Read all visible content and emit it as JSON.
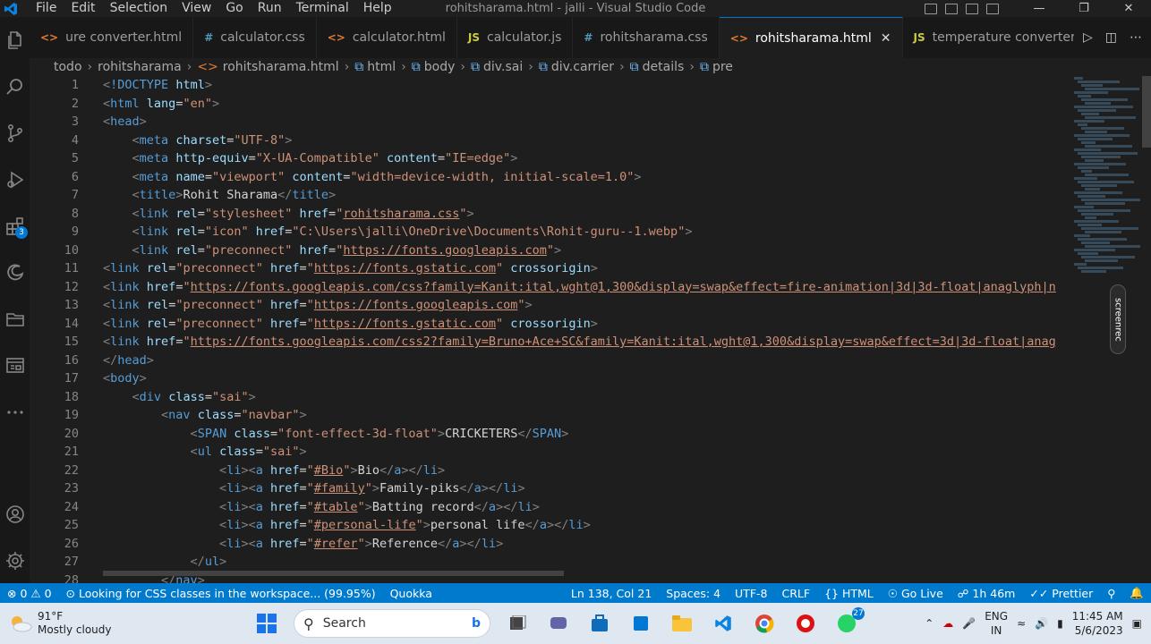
{
  "window": {
    "title": "rohitsharama.html - jalli - Visual Studio Code"
  },
  "menu": [
    "File",
    "Edit",
    "Selection",
    "View",
    "Go",
    "Run",
    "Terminal",
    "Help"
  ],
  "activity_badge": "3",
  "tabs": [
    {
      "label": "ure converter.html",
      "kind": "html",
      "glyph": "<>",
      "active": false
    },
    {
      "label": "calculator.css",
      "kind": "css",
      "glyph": "#",
      "active": false
    },
    {
      "label": "calculator.html",
      "kind": "html",
      "glyph": "<>",
      "active": false
    },
    {
      "label": "calculator.js",
      "kind": "js",
      "glyph": "JS",
      "active": false
    },
    {
      "label": "rohitsharama.css",
      "kind": "css",
      "glyph": "#",
      "active": false
    },
    {
      "label": "rohitsharama.html",
      "kind": "html",
      "glyph": "<>",
      "active": true
    },
    {
      "label": "temperature converter.js",
      "kind": "js",
      "glyph": "JS",
      "active": false
    }
  ],
  "breadcrumb": [
    "todo",
    "rohitsharama",
    "rohitsharama.html",
    "html",
    "body",
    "div.sai",
    "div.carrier",
    "details",
    "pre"
  ],
  "code_lines": [
    {
      "n": "1",
      "html": "<span class='t'>&lt;</span><span class='tg'>!DOCTYPE</span> <span class='at'>html</span><span class='t'>&gt;</span>"
    },
    {
      "n": "2",
      "html": "<span class='t'>&lt;</span><span class='tg'>html</span> <span class='at'>lang</span>=<span class='st'>\"en\"</span><span class='t'>&gt;</span>"
    },
    {
      "n": "3",
      "html": "<span class='t'>&lt;</span><span class='tg'>head</span><span class='t'>&gt;</span>"
    },
    {
      "n": "4",
      "html": "    <span class='t'>&lt;</span><span class='tg'>meta</span> <span class='at'>charset</span>=<span class='st'>\"UTF-8\"</span><span class='t'>&gt;</span>"
    },
    {
      "n": "5",
      "html": "    <span class='t'>&lt;</span><span class='tg'>meta</span> <span class='at'>http-equiv</span>=<span class='st'>\"X-UA-Compatible\"</span> <span class='at'>content</span>=<span class='st'>\"IE=edge\"</span><span class='t'>&gt;</span>"
    },
    {
      "n": "6",
      "html": "    <span class='t'>&lt;</span><span class='tg'>meta</span> <span class='at'>name</span>=<span class='st'>\"viewport\"</span> <span class='at'>content</span>=<span class='st'>\"width=device-width, initial-scale=1.0\"</span><span class='t'>&gt;</span>"
    },
    {
      "n": "7",
      "html": "    <span class='t'>&lt;</span><span class='tg'>title</span><span class='t'>&gt;</span><span class='tx'>Rohit Sharama</span><span class='t'>&lt;/</span><span class='tg'>title</span><span class='t'>&gt;</span>"
    },
    {
      "n": "8",
      "html": "    <span class='t'>&lt;</span><span class='tg'>link</span> <span class='at'>rel</span>=<span class='st'>\"stylesheet\"</span> <span class='at'>href</span>=<span class='st'>\"<span class='u'>rohitsharama.css</span>\"</span><span class='t'>&gt;</span>"
    },
    {
      "n": "9",
      "html": "    <span class='t'>&lt;</span><span class='tg'>link</span> <span class='at'>rel</span>=<span class='st'>\"icon\"</span> <span class='at'>href</span>=<span class='st'>\"C:\\Users\\jalli\\OneDrive\\Documents\\Rohit-guru--1.webp\"</span><span class='t'>&gt;</span>"
    },
    {
      "n": "10",
      "html": "    <span class='t'>&lt;</span><span class='tg'>link</span> <span class='at'>rel</span>=<span class='st'>\"preconnect\"</span> <span class='at'>href</span>=<span class='st'>\"<span class='u'>https://fonts.googleapis.com</span>\"</span><span class='t'>&gt;</span>"
    },
    {
      "n": "11",
      "html": "<span class='t'>&lt;</span><span class='tg'>link</span> <span class='at'>rel</span>=<span class='st'>\"preconnect\"</span> <span class='at'>href</span>=<span class='st'>\"<span class='u'>https://fonts.gstatic.com</span>\"</span> <span class='at'>crossorigin</span><span class='t'>&gt;</span>"
    },
    {
      "n": "12",
      "html": "<span class='t'>&lt;</span><span class='tg'>link</span> <span class='at'>href</span>=<span class='st'>\"<span class='u'>https://fonts.googleapis.com/css?family=Kanit:ital,wght@1,300&amp;display=swap&amp;effect=fire-animation|3d|3d-float|anaglyph|n</span></span>"
    },
    {
      "n": "13",
      "html": "<span class='t'>&lt;</span><span class='tg'>link</span> <span class='at'>rel</span>=<span class='st'>\"preconnect\"</span> <span class='at'>href</span>=<span class='st'>\"<span class='u'>https://fonts.googleapis.com</span>\"</span><span class='t'>&gt;</span>"
    },
    {
      "n": "14",
      "html": "<span class='t'>&lt;</span><span class='tg'>link</span> <span class='at'>rel</span>=<span class='st'>\"preconnect\"</span> <span class='at'>href</span>=<span class='st'>\"<span class='u'>https://fonts.gstatic.com</span>\"</span> <span class='at'>crossorigin</span><span class='t'>&gt;</span>"
    },
    {
      "n": "15",
      "html": "<span class='t'>&lt;</span><span class='tg'>link</span> <span class='at'>href</span>=<span class='st'>\"<span class='u'>https://fonts.googleapis.com/css2?family=Bruno+Ace+SC&amp;family=Kanit:ital,wght@1,300&amp;display=swap&amp;effect=3d|3d-float|anag</span></span>"
    },
    {
      "n": "16",
      "html": "<span class='t'>&lt;/</span><span class='tg'>head</span><span class='t'>&gt;</span>"
    },
    {
      "n": "17",
      "html": "<span class='t'>&lt;</span><span class='tg'>body</span><span class='t'>&gt;</span>"
    },
    {
      "n": "18",
      "html": "    <span class='t'>&lt;</span><span class='tg'>div</span> <span class='at'>class</span>=<span class='st'>\"sai\"</span><span class='t'>&gt;</span>"
    },
    {
      "n": "19",
      "html": "        <span class='t'>&lt;</span><span class='tg'>nav</span> <span class='at'>class</span>=<span class='st'>\"navbar\"</span><span class='t'>&gt;</span>"
    },
    {
      "n": "20",
      "html": "            <span class='t'>&lt;</span><span class='tg'>SPAN</span> <span class='at'>class</span>=<span class='st'>\"font-effect-3d-float\"</span><span class='t'>&gt;</span><span class='tx'>CRICKETERS</span><span class='t'>&lt;/</span><span class='tg'>SPAN</span><span class='t'>&gt;</span>"
    },
    {
      "n": "21",
      "html": "            <span class='t'>&lt;</span><span class='tg'>ul</span> <span class='at'>class</span>=<span class='st'>\"sai\"</span><span class='t'>&gt;</span>"
    },
    {
      "n": "22",
      "html": "                <span class='t'>&lt;</span><span class='tg'>li</span><span class='t'>&gt;&lt;</span><span class='tg'>a</span> <span class='at'>href</span>=<span class='st'>\"<span class='u'>#Bio</span>\"</span><span class='t'>&gt;</span><span class='tx'>Bio</span><span class='t'>&lt;/</span><span class='tg'>a</span><span class='t'>&gt;&lt;/</span><span class='tg'>li</span><span class='t'>&gt;</span>"
    },
    {
      "n": "23",
      "html": "                <span class='t'>&lt;</span><span class='tg'>li</span><span class='t'>&gt;&lt;</span><span class='tg'>a</span> <span class='at'>href</span>=<span class='st'>\"<span class='u'>#family</span>\"</span><span class='t'>&gt;</span><span class='tx'>Family-piks</span><span class='t'>&lt;/</span><span class='tg'>a</span><span class='t'>&gt;&lt;/</span><span class='tg'>li</span><span class='t'>&gt;</span>"
    },
    {
      "n": "24",
      "html": "                <span class='t'>&lt;</span><span class='tg'>li</span><span class='t'>&gt;&lt;</span><span class='tg'>a</span> <span class='at'>href</span>=<span class='st'>\"<span class='u'>#table</span>\"</span><span class='t'>&gt;</span><span class='tx'>Batting record</span><span class='t'>&lt;/</span><span class='tg'>a</span><span class='t'>&gt;&lt;/</span><span class='tg'>li</span><span class='t'>&gt;</span>"
    },
    {
      "n": "25",
      "html": "                <span class='t'>&lt;</span><span class='tg'>li</span><span class='t'>&gt;&lt;</span><span class='tg'>a</span> <span class='at'>href</span>=<span class='st'>\"<span class='u'>#personal-life</span>\"</span><span class='t'>&gt;</span><span class='tx'>personal life</span><span class='t'>&lt;/</span><span class='tg'>a</span><span class='t'>&gt;&lt;/</span><span class='tg'>li</span><span class='t'>&gt;</span>"
    },
    {
      "n": "26",
      "html": "                <span class='t'>&lt;</span><span class='tg'>li</span><span class='t'>&gt;&lt;</span><span class='tg'>a</span> <span class='at'>href</span>=<span class='st'>\"<span class='u'>#refer</span>\"</span><span class='t'>&gt;</span><span class='tx'>Reference</span><span class='t'>&lt;/</span><span class='tg'>a</span><span class='t'>&gt;&lt;/</span><span class='tg'>li</span><span class='t'>&gt;</span>"
    },
    {
      "n": "27",
      "html": "            <span class='t'>&lt;/</span><span class='tg'>ul</span><span class='t'>&gt;</span>"
    },
    {
      "n": "28",
      "html": "        <span class='t'>&lt;/</span><span class='tg'>nav</span><span class='t'>&gt;</span>"
    }
  ],
  "screenrec_label": "screenrec",
  "status": {
    "errors": "0",
    "warnings": "0",
    "message": "Looking for CSS classes in the workspace... (99.95%)",
    "quokka": "Quokka",
    "position": "Ln 138, Col 21",
    "spaces": "Spaces: 4",
    "encoding": "UTF-8",
    "eol": "CRLF",
    "language": "HTML",
    "golive": "Go Live",
    "time_tracked": "1h 46m",
    "prettier": "Prettier"
  },
  "taskbar": {
    "temp": "91°F",
    "weather": "Mostly cloudy",
    "search_placeholder": "Search",
    "whatsapp_badge": "27",
    "lang_top": "ENG",
    "lang_bottom": "IN",
    "time": "11:45 AM",
    "date": "5/6/2023"
  }
}
